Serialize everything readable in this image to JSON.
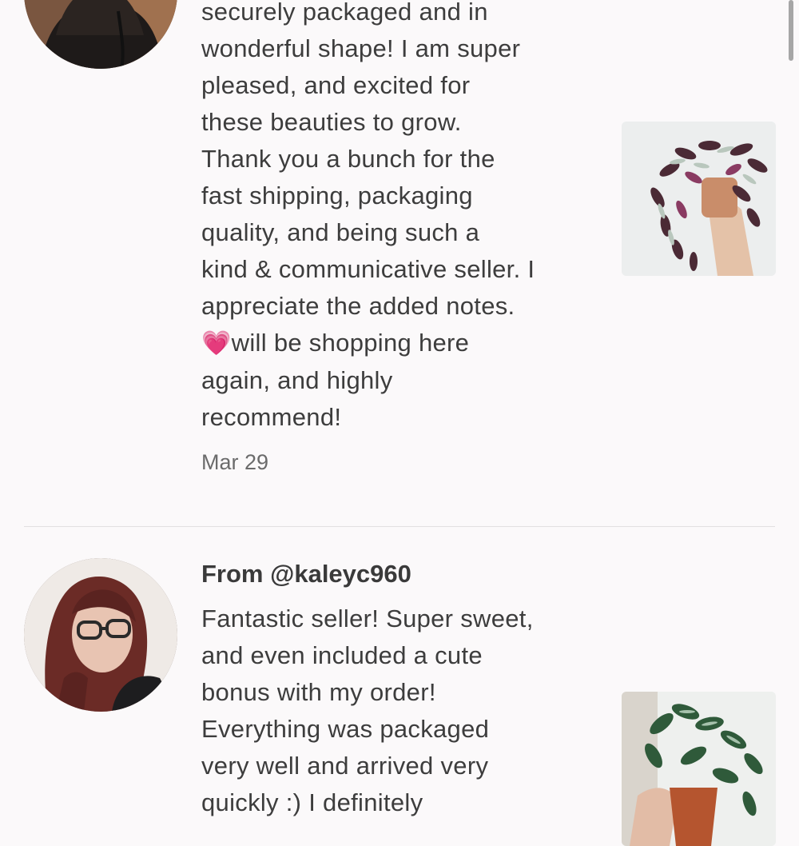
{
  "reviews": [
    {
      "text": "securely packaged and in\nwonderful shape! I am super\npleased, and excited for\nthese beauties to grow.\nThank you a bunch for the\nfast shipping, packaging\nquality, and being such a\nkind & communicative seller. I\nappreciate the added notes.",
      "heart": "💗",
      "text_after_heart": "will be shopping here\nagain, and highly\nrecommend!",
      "date": "Mar 29"
    },
    {
      "from": "From @kaleyc960",
      "text": "Fantastic seller! Super sweet,\nand even included a cute\nbonus with my order!\nEverything was packaged\nvery well and arrived very\nquickly :) I definitely"
    }
  ],
  "icons": {
    "scrollbar": "scrollbar-thumb"
  },
  "colors": {
    "background": "#fbf9fa",
    "text": "#3d3d3d",
    "date": "#6b6b6b",
    "divider": "#e2e0e1"
  }
}
